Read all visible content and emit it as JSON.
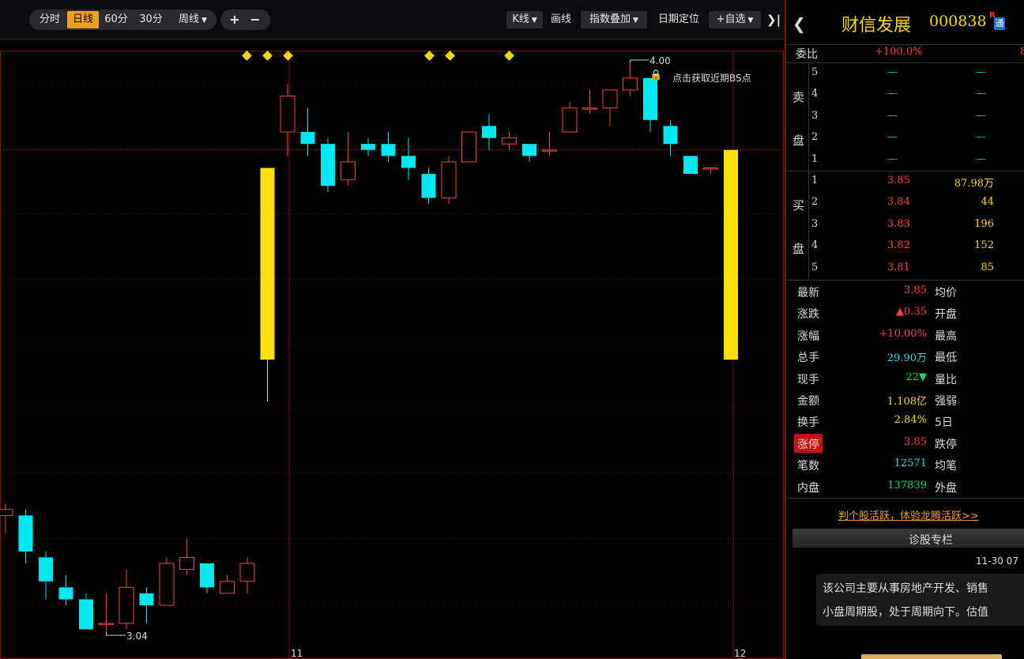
{
  "toolbar": {
    "periods": [
      {
        "label": "分时",
        "active": false
      },
      {
        "label": "日线",
        "active": true
      },
      {
        "label": "60分",
        "active": false
      },
      {
        "label": "30分",
        "active": false
      },
      {
        "label": "周线",
        "active": false
      }
    ],
    "zoom_in": "+",
    "zoom_out": "−",
    "kline_label": "K线",
    "draw_label": "画线",
    "index_overlay_label": "指数叠加",
    "date_locate_label": "日期定位",
    "watchlist_label": "+自选"
  },
  "chart_data": {
    "type": "candlestick",
    "high_label": "4.00",
    "low_label": "3.04",
    "bs_hint": "点击获取近期BS点",
    "date_labels": [
      "11",
      "12"
    ],
    "reference_price": 3.85,
    "colors": {
      "up": "#ff4040",
      "down": "#00e8f0",
      "limit_up": "#ffe000"
    },
    "candles": [
      {
        "o": 3.24,
        "h": 3.26,
        "l": 3.21,
        "c": 3.25
      },
      {
        "o": 3.24,
        "h": 3.25,
        "l": 3.16,
        "c": 3.18
      },
      {
        "o": 3.17,
        "h": 3.18,
        "l": 3.1,
        "c": 3.13
      },
      {
        "o": 3.12,
        "h": 3.14,
        "l": 3.09,
        "c": 3.1
      },
      {
        "o": 3.1,
        "h": 3.11,
        "l": 3.05,
        "c": 3.05
      },
      {
        "o": 3.06,
        "h": 3.11,
        "l": 3.04,
        "c": 3.06
      },
      {
        "o": 3.06,
        "h": 3.15,
        "l": 3.05,
        "c": 3.12
      },
      {
        "o": 3.11,
        "h": 3.12,
        "l": 3.06,
        "c": 3.09
      },
      {
        "o": 3.09,
        "h": 3.17,
        "l": 3.09,
        "c": 3.16
      },
      {
        "o": 3.15,
        "h": 3.2,
        "l": 3.14,
        "c": 3.17
      },
      {
        "o": 3.16,
        "h": 3.16,
        "l": 3.11,
        "c": 3.12
      },
      {
        "o": 3.11,
        "h": 3.14,
        "l": 3.11,
        "c": 3.13
      },
      {
        "o": 3.13,
        "h": 3.17,
        "l": 3.11,
        "c": 3.16
      },
      {
        "o": 3.5,
        "h": 3.5,
        "l": 3.43,
        "c": 3.82
      },
      {
        "o": 3.88,
        "h": 3.96,
        "l": 3.84,
        "c": 3.94
      },
      {
        "o": 3.88,
        "h": 3.92,
        "l": 3.84,
        "c": 3.86
      },
      {
        "o": 3.86,
        "h": 3.87,
        "l": 3.78,
        "c": 3.79
      },
      {
        "o": 3.8,
        "h": 3.88,
        "l": 3.79,
        "c": 3.83
      },
      {
        "o": 3.86,
        "h": 3.87,
        "l": 3.84,
        "c": 3.85
      },
      {
        "o": 3.86,
        "h": 3.88,
        "l": 3.83,
        "c": 3.84
      },
      {
        "o": 3.84,
        "h": 3.87,
        "l": 3.8,
        "c": 3.82
      },
      {
        "o": 3.81,
        "h": 3.82,
        "l": 3.76,
        "c": 3.77
      },
      {
        "o": 3.77,
        "h": 3.84,
        "l": 3.76,
        "c": 3.83
      },
      {
        "o": 3.83,
        "h": 3.88,
        "l": 3.83,
        "c": 3.88
      },
      {
        "o": 3.89,
        "h": 3.91,
        "l": 3.85,
        "c": 3.87
      },
      {
        "o": 3.86,
        "h": 3.88,
        "l": 3.85,
        "c": 3.87
      },
      {
        "o": 3.86,
        "h": 3.86,
        "l": 3.83,
        "c": 3.84
      },
      {
        "o": 3.85,
        "h": 3.88,
        "l": 3.84,
        "c": 3.85
      },
      {
        "o": 3.88,
        "h": 3.93,
        "l": 3.88,
        "c": 3.92
      },
      {
        "o": 3.92,
        "h": 3.95,
        "l": 3.91,
        "c": 3.92
      },
      {
        "o": 3.92,
        "h": 3.95,
        "l": 3.89,
        "c": 3.95
      },
      {
        "o": 3.95,
        "h": 4.0,
        "l": 3.94,
        "c": 3.97
      },
      {
        "o": 3.97,
        "h": 3.97,
        "l": 3.88,
        "c": 3.9
      },
      {
        "o": 3.89,
        "h": 3.9,
        "l": 3.84,
        "c": 3.86
      },
      {
        "o": 3.84,
        "h": 3.84,
        "l": 3.81,
        "c": 3.81
      },
      {
        "o": 3.82,
        "h": 3.82,
        "l": 3.81,
        "c": 3.82
      },
      {
        "o": 3.5,
        "h": 3.85,
        "l": 3.5,
        "c": 3.85
      }
    ]
  },
  "quote": {
    "back_icon": "chevron-left-icon",
    "name": "财信发展",
    "code": "000838",
    "badge_r": "R",
    "badge_tong": "通",
    "webi_label": "委比",
    "webi_value": "+100.0%",
    "webi_extra": "8",
    "sell_label_1": "卖",
    "sell_label_2": "盘",
    "buy_label_1": "买",
    "buy_label_2": "盘",
    "sell": [
      {
        "level": "5",
        "price": "—",
        "vol": "—"
      },
      {
        "level": "4",
        "price": "—",
        "vol": "—"
      },
      {
        "level": "3",
        "price": "—",
        "vol": "—"
      },
      {
        "level": "2",
        "price": "—",
        "vol": "—"
      },
      {
        "level": "1",
        "price": "—",
        "vol": "—"
      }
    ],
    "buy": [
      {
        "level": "1",
        "price": "3.85",
        "vol": "87.98万"
      },
      {
        "level": "2",
        "price": "3.84",
        "vol": "44"
      },
      {
        "level": "3",
        "price": "3.83",
        "vol": "196"
      },
      {
        "level": "4",
        "price": "3.82",
        "vol": "152"
      },
      {
        "level": "5",
        "price": "3.81",
        "vol": "85"
      }
    ],
    "stats": [
      {
        "label": "最新",
        "value": "3.85",
        "color": "red",
        "label2": "均价"
      },
      {
        "label": "涨跌",
        "value": "▲0.35",
        "color": "red",
        "label2": "开盘"
      },
      {
        "label": "涨幅",
        "value": "+10.00%",
        "color": "red",
        "label2": "最高"
      },
      {
        "label": "总手",
        "value": "29.90万",
        "color": "cyan",
        "label2": "最低"
      },
      {
        "label": "现手",
        "value": "22▼",
        "color": "green",
        "label2": "量比"
      },
      {
        "label": "金额",
        "value": "1.108亿",
        "color": "yellow",
        "label2": "强弱"
      },
      {
        "label": "换手",
        "value": "2.84%",
        "color": "yellow",
        "label2": "5日"
      },
      {
        "label": "涨停",
        "value": "3.85",
        "color": "red",
        "label2": "跌停"
      },
      {
        "label": "笔数",
        "value": "12571",
        "color": "cyan",
        "label2": "均笔"
      },
      {
        "label": "内盘",
        "value": "137839",
        "color": "green",
        "label2": "外盘"
      }
    ],
    "promo_link": "判个股活跃，体验龙腾活跃>>",
    "diag_title": "诊股专栏",
    "diag_date": "11-30 07",
    "diag_line1": "该公司主要从事房地产开发、销售",
    "diag_line2": "小盘周期股，处于周期向下。估值"
  }
}
